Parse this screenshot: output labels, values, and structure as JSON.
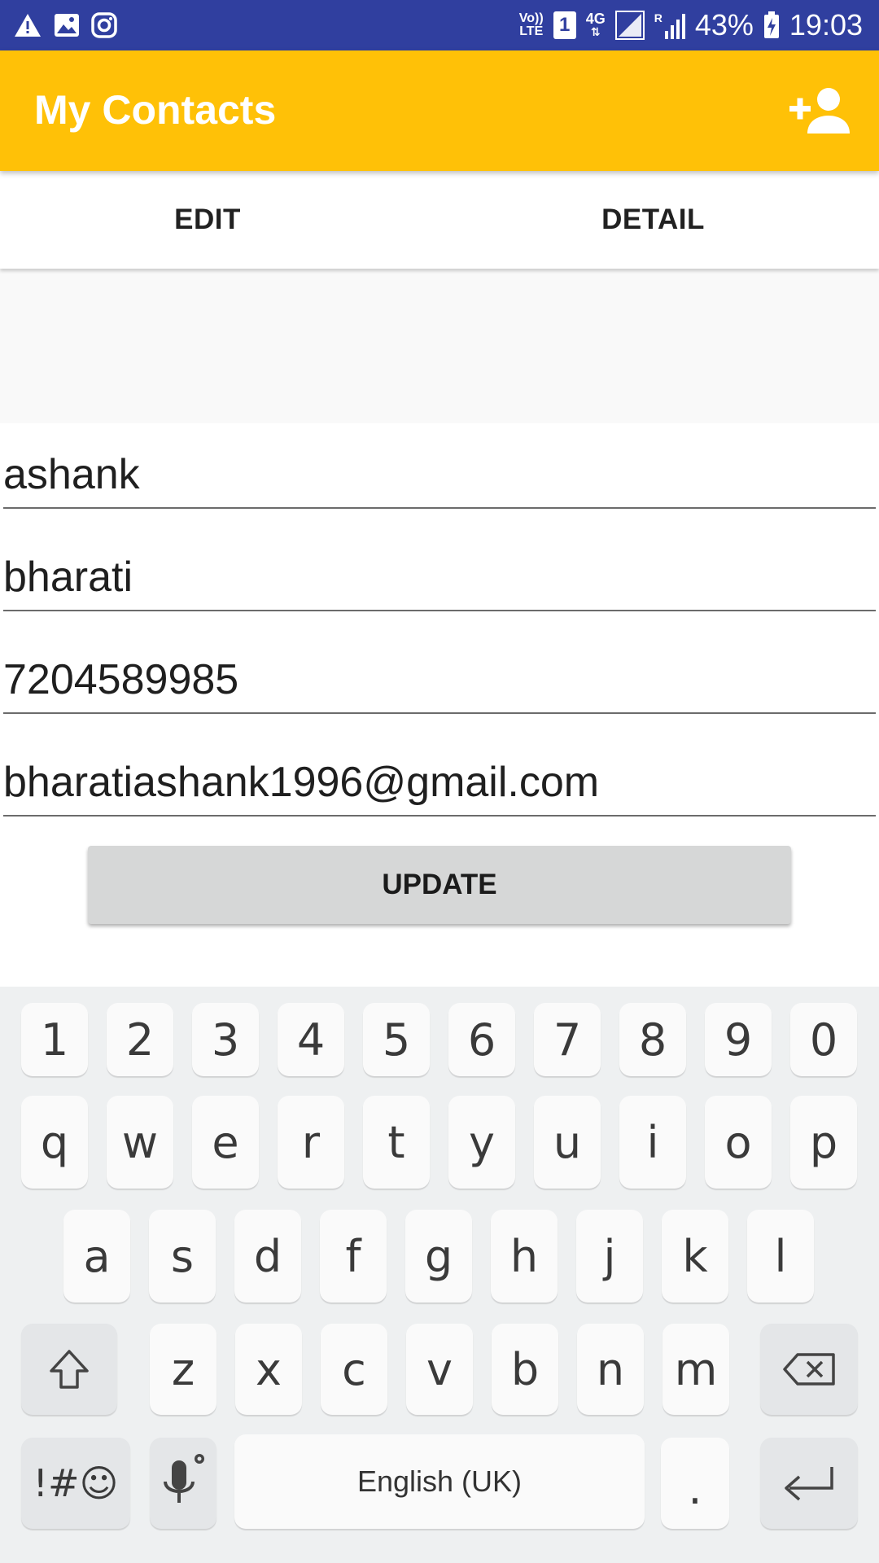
{
  "status_bar": {
    "volte_top": "Vo))",
    "volte_bottom": "LTE",
    "sim_slot": "1",
    "network": "4G",
    "roaming": "R",
    "battery": "43%",
    "time": "19:03",
    "background": "#303F9F"
  },
  "app_bar": {
    "title": "My Contacts",
    "background": "#FFC107",
    "action_icon": "add-contact-icon"
  },
  "tabs": [
    {
      "label": "EDIT"
    },
    {
      "label": "DETAIL"
    }
  ],
  "form": {
    "first_name": "ashank",
    "last_name": "bharati",
    "phone": "7204589985",
    "email": "bharatiashank1996@gmail.com",
    "update_label": "UPDATE"
  },
  "keyboard": {
    "row_numbers": [
      "1",
      "2",
      "3",
      "4",
      "5",
      "6",
      "7",
      "8",
      "9",
      "0"
    ],
    "row1": [
      "q",
      "w",
      "e",
      "r",
      "t",
      "y",
      "u",
      "i",
      "o",
      "p"
    ],
    "row2": [
      "a",
      "s",
      "d",
      "f",
      "g",
      "h",
      "j",
      "k",
      "l"
    ],
    "row3": [
      "z",
      "x",
      "c",
      "v",
      "b",
      "n",
      "m"
    ],
    "symbols_label": "!#☺",
    "space_label": "English (UK)",
    "period_label": "."
  }
}
